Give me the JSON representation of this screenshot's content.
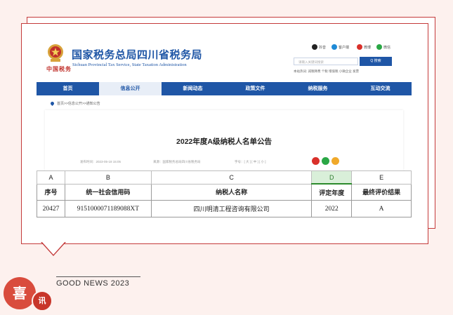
{
  "site": {
    "emblem_text": "中国税务",
    "title": "国家税务总局四川省税务局",
    "subtitle": "Sichuan Provincial Tax Service, State Taxation Administration",
    "social": [
      {
        "label": "抖音",
        "icon": "douyin-icon",
        "color": "#222222"
      },
      {
        "label": "客户端",
        "icon": "app-icon",
        "color": "#1f8ad6"
      },
      {
        "label": "微博",
        "icon": "weibo-icon",
        "color": "#d9302a"
      },
      {
        "label": "微信",
        "icon": "wechat-icon",
        "color": "#2aa745"
      }
    ],
    "search_placeholder": "请输入关键词搜索",
    "search_button": "Q 搜索",
    "hot_words": "本站热词: 减税降费  个税  增值税  小微企业  发票"
  },
  "nav": [
    {
      "label": "首页",
      "active": false
    },
    {
      "label": "信息公开",
      "active": true
    },
    {
      "label": "新闻动态",
      "active": false
    },
    {
      "label": "政策文件",
      "active": false
    },
    {
      "label": "纳税服务",
      "active": false
    },
    {
      "label": "互动交流",
      "active": false
    }
  ],
  "breadcrumb": "首页>>信息公开>>通知公告",
  "article": {
    "title": "2022年度A级纳税人名单公告",
    "publish_time": "发布时间：2023-05-18 15:05",
    "source": "来源：国家税务总局四川省税务局",
    "font_size": "字号：[ 大 ] [ 中 ] [ 小 ]"
  },
  "spreadsheet": {
    "column_letters": [
      "A",
      "B",
      "C",
      "D",
      "E"
    ],
    "selected_column": "D",
    "headers": [
      "序号",
      "统一社会信用码",
      "纳税人名称",
      "评定年度",
      "最终评价结果"
    ],
    "rows": [
      [
        "20427",
        "9151000071189088XT",
        "四川明清工程咨询有限公司",
        "2022",
        "A"
      ]
    ]
  },
  "footer": {
    "tagline": "GOOD NEWS 2023",
    "badge_big": "喜",
    "badge_small": "讯"
  },
  "colors": {
    "brand_blue": "#1f56a6",
    "frame_red": "#c43a3a",
    "badge_red": "#d94c3d",
    "background": "#fdf1ee"
  }
}
